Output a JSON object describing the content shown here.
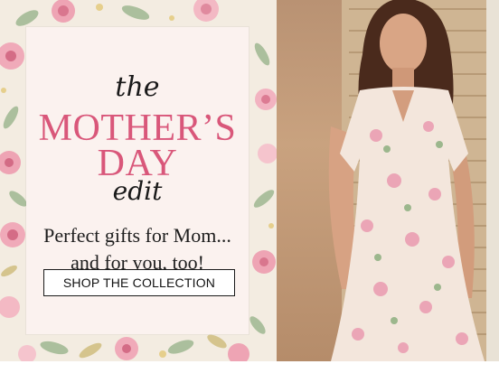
{
  "promo": {
    "kicker_top": "the",
    "title_line1": "MOTHER’S",
    "title_line2": "DAY",
    "kicker_bottom": "edit",
    "tagline_line1": "Perfect gifts for Mom...",
    "tagline_line2": "and for you, too!",
    "cta_label": "SHOP THE COLLECTION"
  },
  "colors": {
    "accent_pink": "#d9577a",
    "card_bg": "#fbf2ef",
    "text_dark": "#1a1a1a"
  }
}
